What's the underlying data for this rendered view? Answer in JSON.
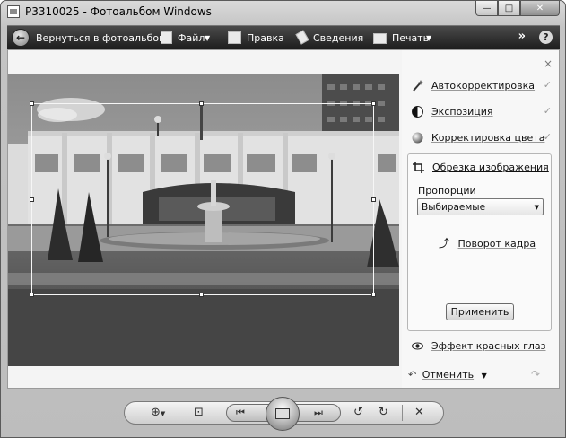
{
  "window": {
    "title": "P3310025 - Фотоальбом Windows",
    "minimize": "—",
    "maximize": "□",
    "close": "✕"
  },
  "toolbar": {
    "back_label": "Вернуться в фотоальбом",
    "file_label": "Файл",
    "edit_label": "Правка",
    "info_label": "Сведения",
    "print_label": "Печать",
    "more": "»",
    "help": "?"
  },
  "panel": {
    "close": "×",
    "tools": [
      {
        "label": "Автокорректировка",
        "check": "✓",
        "icon": "magic-wand-icon"
      },
      {
        "label": "Экспозиция",
        "check": "✓",
        "icon": "exposure-icon"
      },
      {
        "label": "Корректировка цвета",
        "check": "✓",
        "icon": "color-ball-icon"
      }
    ],
    "crop": {
      "title": "Обрезка изображения",
      "proportions_label": "Пропорции",
      "proportions_value": "Выбираемые",
      "rotate_label": "Поворот кадра",
      "apply_label": "Применить"
    },
    "redeye_label": "Эффект красных глаз",
    "undo_label": "Отменить"
  },
  "colors": {
    "toolbar_bg": "#2a2a2a",
    "frame": "#c8c8c8",
    "panel_bg": "#f7f7f7"
  }
}
